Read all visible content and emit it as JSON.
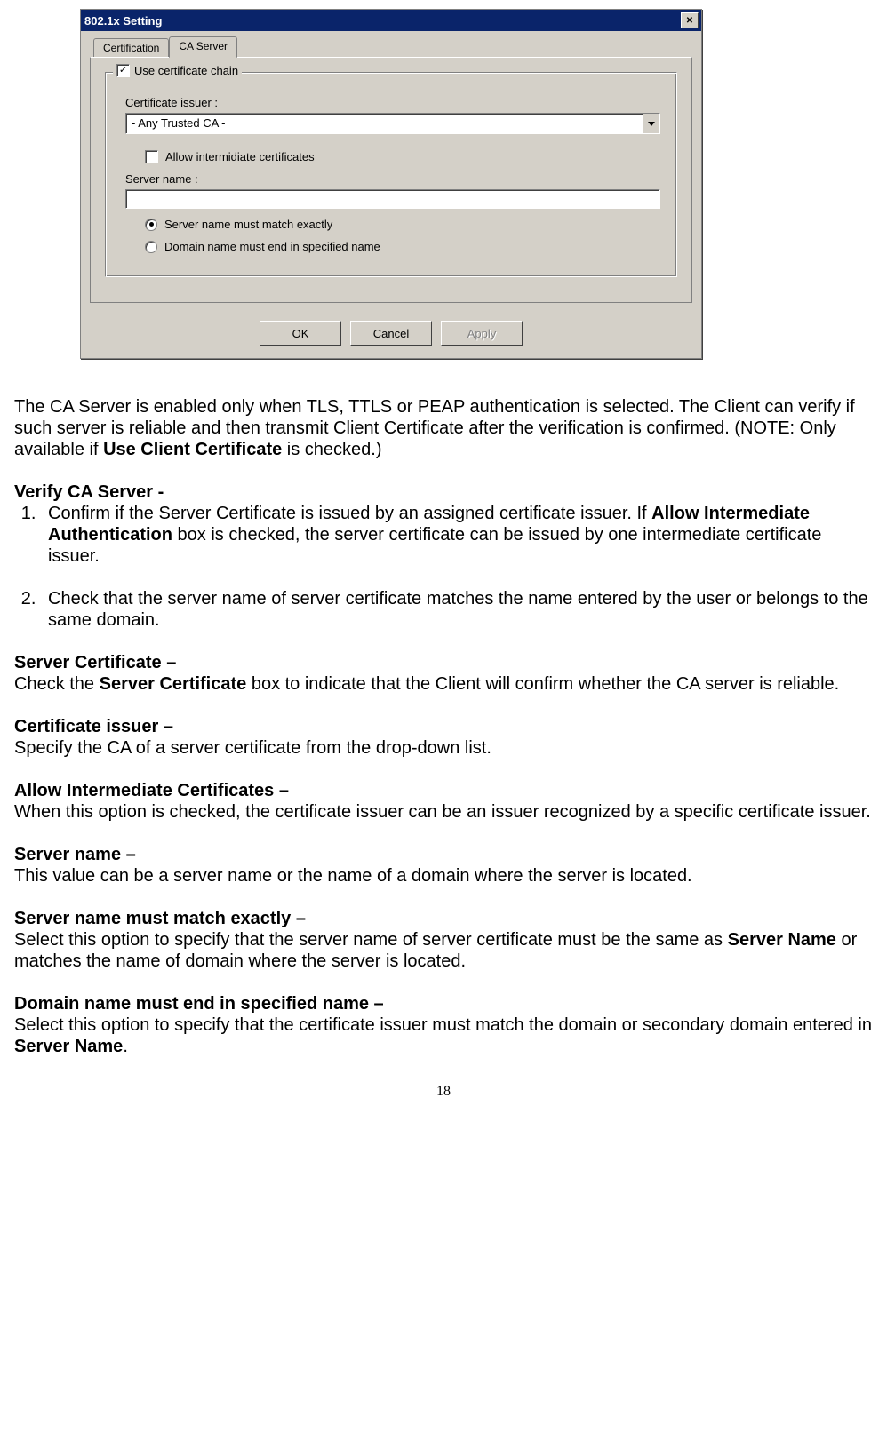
{
  "dialog": {
    "title": "802.1x Setting",
    "close_glyph": "✕",
    "tabs": {
      "certification": "Certification",
      "ca_server": "CA Server"
    },
    "group": {
      "use_chain_checked": "✓",
      "use_chain_label": "Use certificate chain",
      "issuer_label": "Certificate issuer :",
      "issuer_value": "- Any Trusted CA -",
      "allow_intermediate_label": "Allow intermidiate certificates",
      "server_name_label": "Server name :",
      "server_name_value": "",
      "radio1": "Server name must match exactly",
      "radio2": "Domain name must end in specified name"
    },
    "buttons": {
      "ok": "OK",
      "cancel": "Cancel",
      "apply": "Apply"
    }
  },
  "doc": {
    "p_intro_1": "The CA Server is enabled only when TLS, TTLS or PEAP authentication is selected. The Client can verify if such server is reliable and then transmit Client Certificate after the verification is confirmed. (NOTE: Only available if ",
    "p_intro_bold": "Use Client Certificate",
    "p_intro_2": " is checked.)",
    "verify_head": "Verify CA Server -",
    "li1_a": "Confirm if the Server Certificate is issued by an assigned certificate issuer. If ",
    "li1_bold": "Allow Intermediate Authentication",
    "li1_b": " box is checked, the server certificate can be issued by one intermediate certificate issuer.",
    "li2": "Check that the server name of server certificate matches the name entered by the user or belongs to the same domain.",
    "sc_head": "Server Certificate –",
    "sc_a": "Check the ",
    "sc_bold": "Server Certificate",
    "sc_b": " box to indicate that the Client will confirm whether the CA server is reliable.",
    "ci_head": "Certificate issuer –",
    "ci_body": "Specify the CA of a server certificate from the drop-down list.",
    "aic_head": "Allow Intermediate Certificates –",
    "aic_body": "When this option is checked, the certificate issuer can be an issuer recognized by a specific certificate issuer.",
    "sn_head": "Server name –",
    "sn_body": "This value can be a server name or the name of a domain where the server is located.",
    "sme_head": "Server name must match exactly –",
    "sme_a": "Select this option to specify that the server name of server certificate must be the same as ",
    "sme_bold": "Server Name",
    "sme_b": " or matches the name of domain where the server is located.",
    "dne_head": "Domain name must end in specified name –",
    "dne_a": "Select this option to specify that the certificate issuer must match the domain or secondary domain entered in ",
    "dne_bold": "Server Name",
    "dne_b": "."
  },
  "page_number": "18"
}
